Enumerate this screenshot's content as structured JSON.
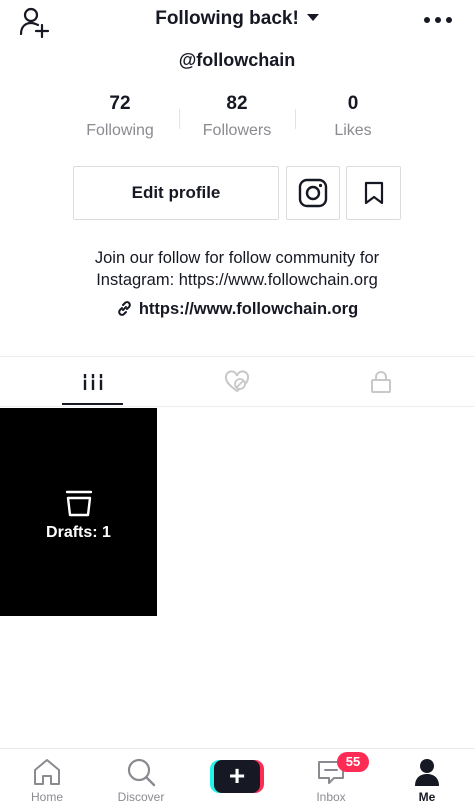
{
  "header": {
    "title": "Following back!",
    "add_user_icon": "add-user-icon",
    "menu_icon": "more-icon"
  },
  "profile": {
    "handle": "@followchain",
    "stats": [
      {
        "value": "72",
        "label": "Following"
      },
      {
        "value": "82",
        "label": "Followers"
      },
      {
        "value": "0",
        "label": "Likes"
      }
    ],
    "edit_button": "Edit profile",
    "bio_line1": "Join our follow for follow community for",
    "bio_line2": "Instagram: https://www.followchain.org",
    "link": "https://www.followchain.org"
  },
  "tabs": [
    {
      "icon": "grid-icon",
      "active": true
    },
    {
      "icon": "liked-hidden-icon",
      "active": false
    },
    {
      "icon": "lock-icon",
      "active": false
    }
  ],
  "drafts": {
    "label": "Drafts: 1"
  },
  "bottom_nav": {
    "items": [
      {
        "label": "Home",
        "icon": "home-icon"
      },
      {
        "label": "Discover",
        "icon": "search-icon"
      },
      {
        "label": "",
        "icon": "create-icon"
      },
      {
        "label": "Inbox",
        "icon": "inbox-icon"
      },
      {
        "label": "Me",
        "icon": "profile-icon",
        "active": true
      }
    ],
    "inbox_badge": "55"
  },
  "colors": {
    "text": "#161823",
    "muted": "#8a8b91",
    "badge": "#fe2c55",
    "cyan": "#25f4ee"
  }
}
